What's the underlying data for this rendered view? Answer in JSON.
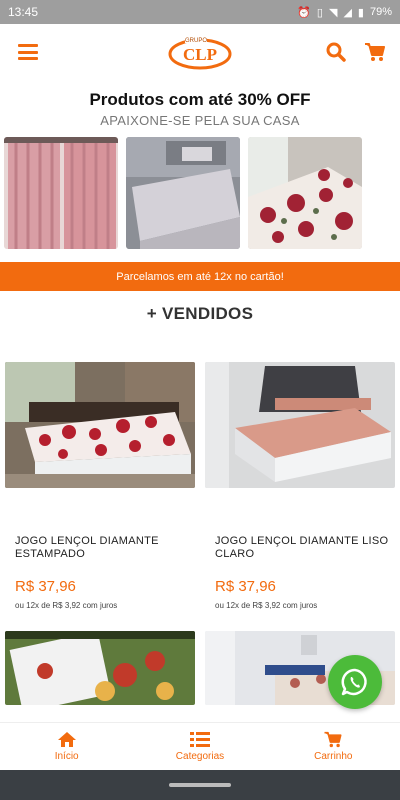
{
  "status_bar": {
    "time": "13:45",
    "battery": "79%"
  },
  "header": {
    "logo_alt": "GRUPO CLP"
  },
  "promo": {
    "title": "Produtos com até 30% OFF",
    "subtitle": "APAIXONE-SE PELA SUA CASA"
  },
  "notice": "Parcelamos em até 12x no cartão!",
  "section": {
    "title": "+ VENDIDOS"
  },
  "products": [
    {
      "name": "JOGO LENÇOL DIAMANTE ESTAMPADO",
      "price": "R$ 37,96",
      "installments": "ou 12x de R$ 3,92 com juros"
    },
    {
      "name": "JOGO LENÇOL DIAMANTE LISO CLARO",
      "price": "R$ 37,96",
      "installments": "ou 12x de R$ 3,92 com juros"
    }
  ],
  "nav": {
    "home": "Início",
    "categories": "Categorias",
    "cart": "Carrinho"
  },
  "colors": {
    "accent": "#f26b0f",
    "whatsapp": "#4cbb3a"
  }
}
